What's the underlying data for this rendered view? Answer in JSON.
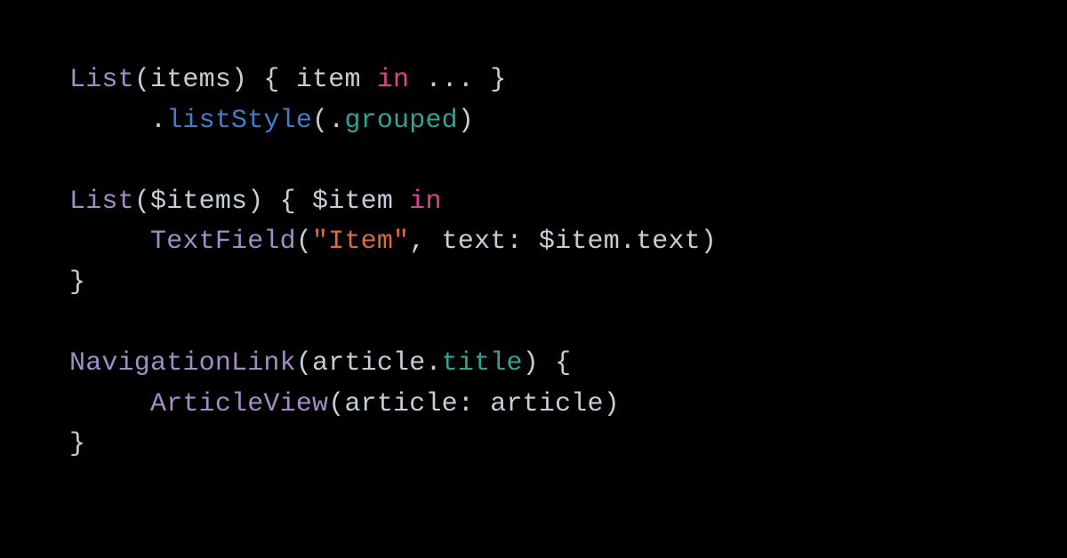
{
  "code": {
    "line1": {
      "type": "List",
      "open": "(items) { item ",
      "in": "in",
      "rest": " ... }"
    },
    "line2": {
      "indent": "     ",
      "dot": ".",
      "method": "listStyle",
      "open": "(.",
      "enum": "grouped",
      "close": ")"
    },
    "line3": "",
    "line4": {
      "type": "List",
      "open": "($items) { $item ",
      "in": "in"
    },
    "line5": {
      "indent": "     ",
      "type": "TextField",
      "open": "(",
      "string": "\"Item\"",
      "rest": ", text: $item.text)"
    },
    "line6": {
      "text": "}"
    },
    "line7": "",
    "line8": {
      "type": "NavigationLink",
      "open": "(article.",
      "prop": "title",
      "rest": ") {"
    },
    "line9": {
      "indent": "     ",
      "type": "ArticleView",
      "rest": "(article: article)"
    },
    "line10": {
      "text": "}"
    }
  },
  "colors": {
    "background": "#000000",
    "default": "#c6cdd5",
    "type": "#a38bc7",
    "method": "#3e7dd0",
    "enum": "#2fa396",
    "keyword": "#d9448d",
    "string": "#e06b3a"
  }
}
